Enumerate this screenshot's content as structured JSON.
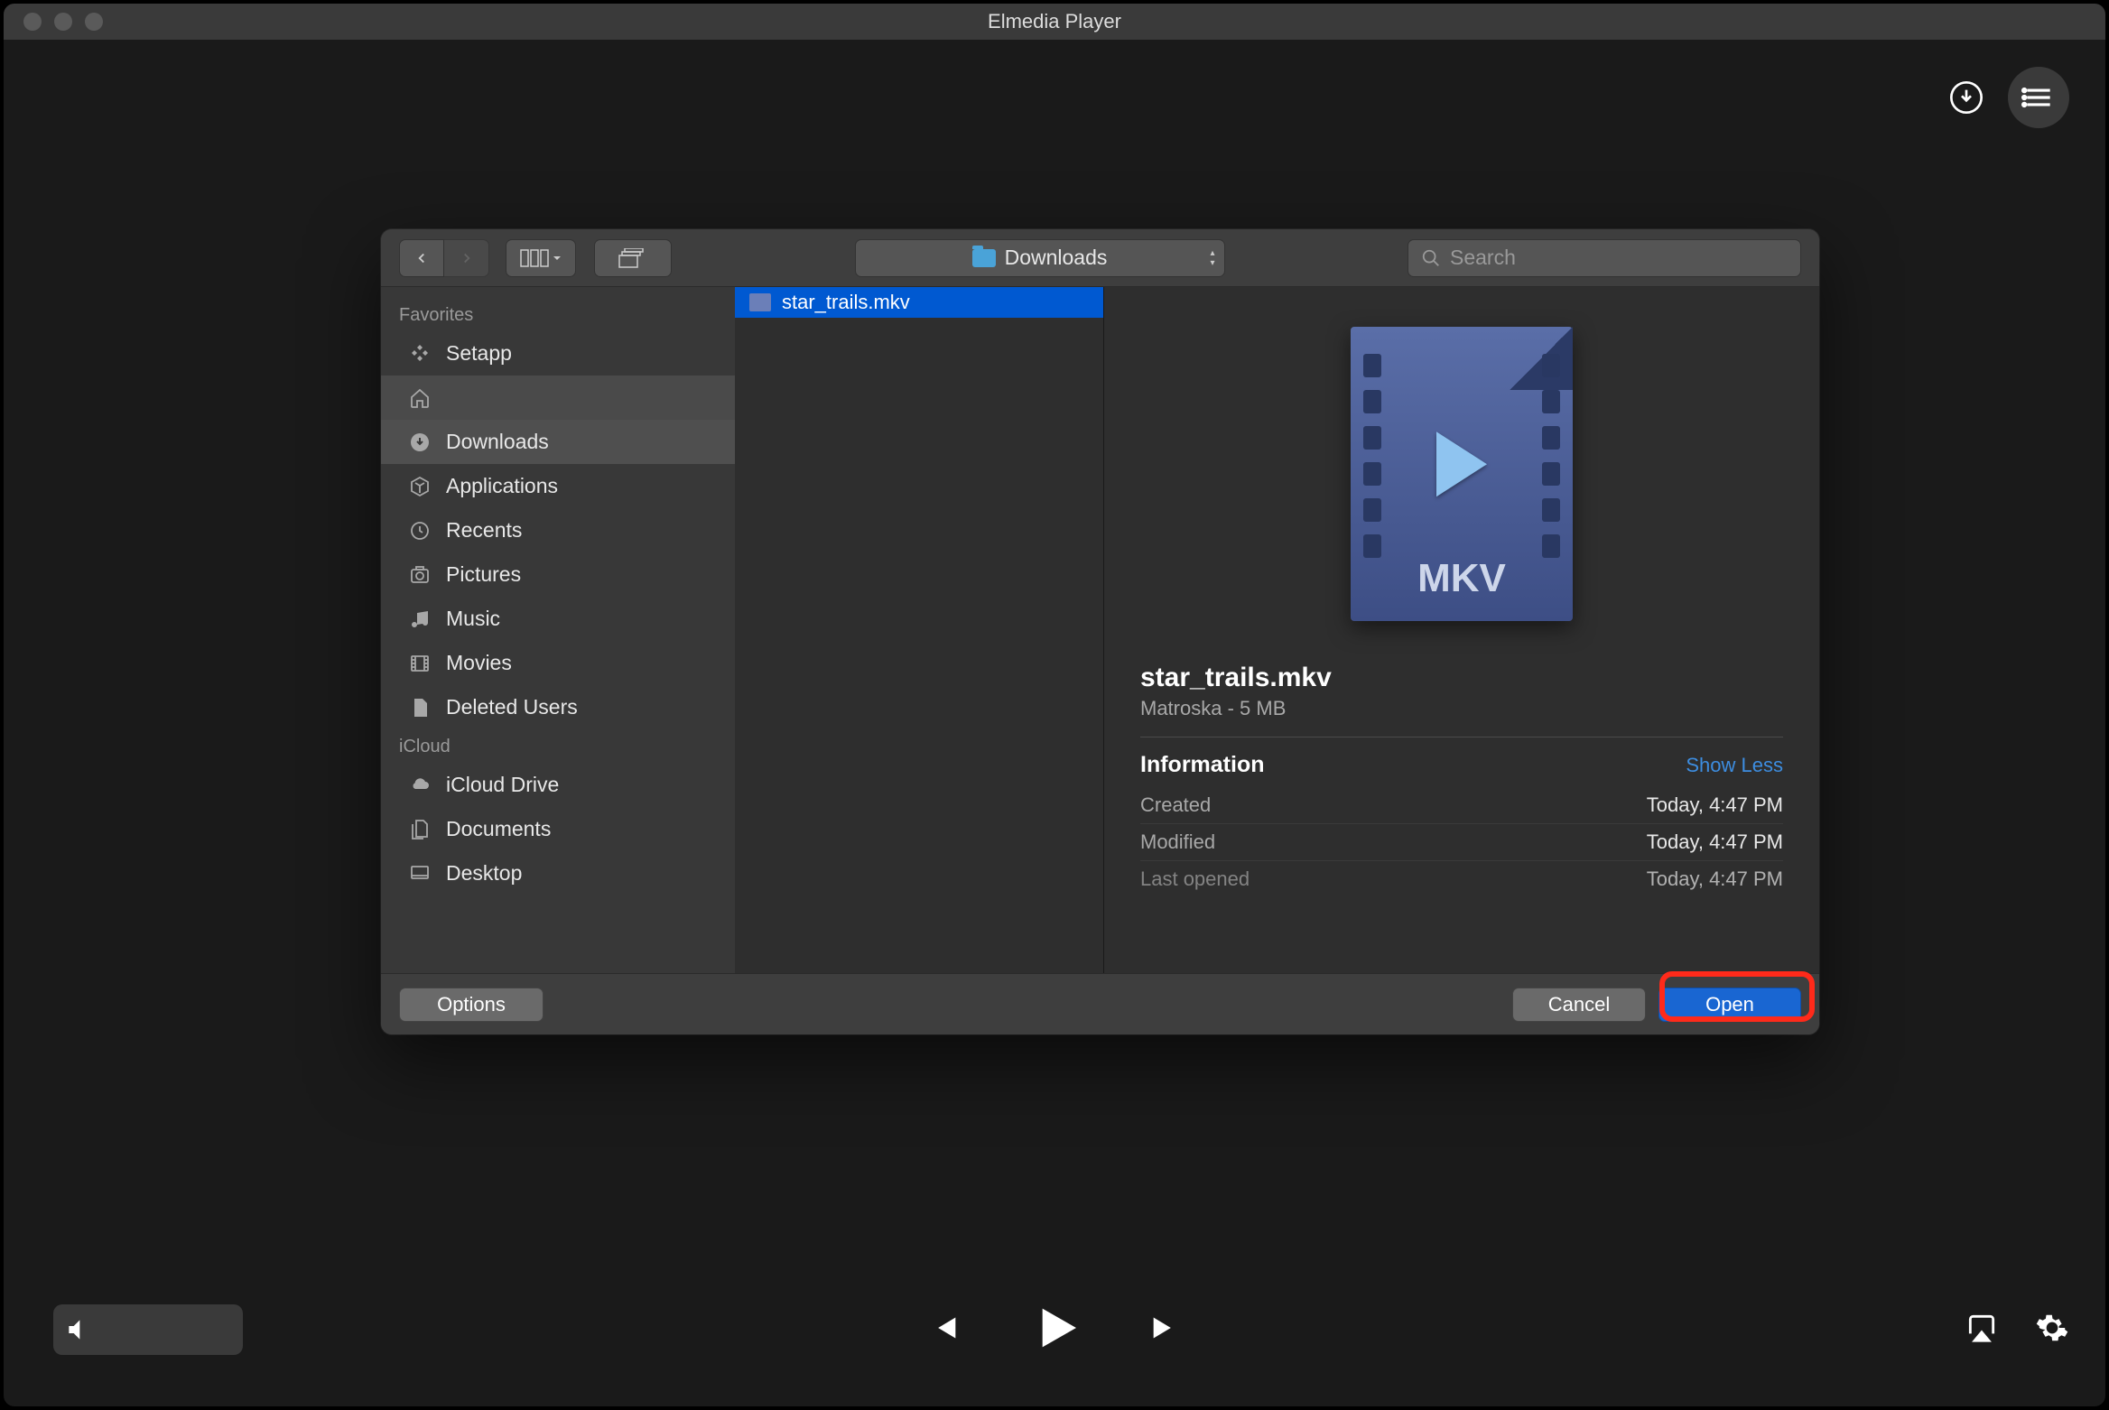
{
  "window": {
    "title": "Elmedia Player"
  },
  "dialog": {
    "location": "Downloads",
    "search_placeholder": "Search",
    "sidebar": {
      "sections": [
        {
          "title": "Favorites",
          "items": [
            "Setapp",
            "",
            "Downloads",
            "Applications",
            "Recents",
            "Pictures",
            "Music",
            "Movies",
            "Deleted Users"
          ]
        },
        {
          "title": "iCloud",
          "items": [
            "iCloud Drive",
            "Documents",
            "Desktop"
          ]
        }
      ]
    },
    "files": [
      "star_trails.mkv"
    ],
    "preview": {
      "filename": "star_trails.mkv",
      "subtitle": "Matroska - 5 MB",
      "thumb_badge": "MKV",
      "info_label": "Information",
      "show_less": "Show Less",
      "rows": [
        {
          "label": "Created",
          "value": "Today, 4:47 PM"
        },
        {
          "label": "Modified",
          "value": "Today, 4:47 PM"
        },
        {
          "label": "Last opened",
          "value": "Today, 4:47 PM"
        }
      ]
    },
    "buttons": {
      "options": "Options",
      "cancel": "Cancel",
      "open": "Open"
    }
  }
}
